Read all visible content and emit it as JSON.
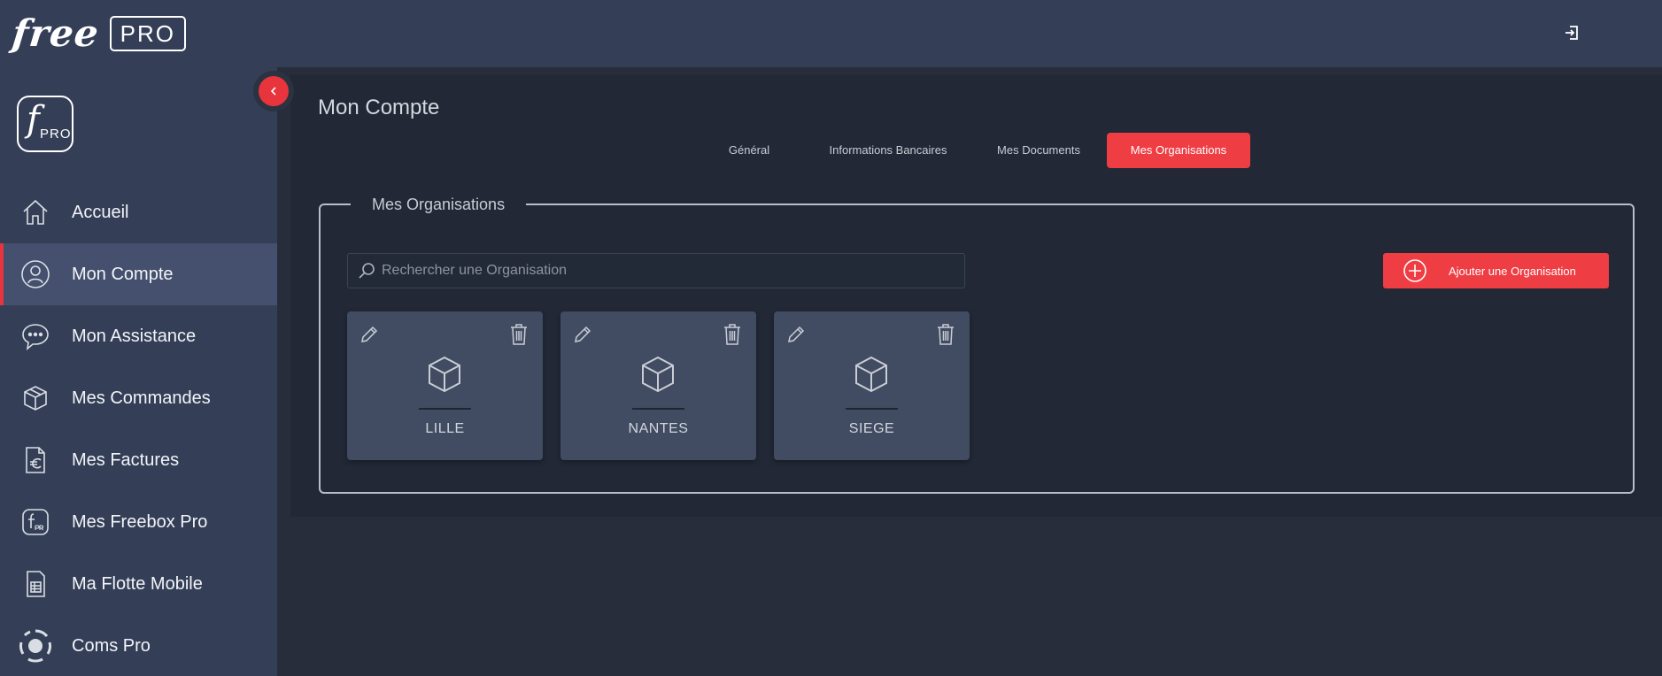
{
  "brand": {
    "word": "free",
    "badge": "PRO",
    "logo_f": "f",
    "logo_pro": "PRO"
  },
  "sidebar": {
    "items": [
      {
        "label": "Accueil",
        "icon": "home-icon",
        "active": false
      },
      {
        "label": "Mon Compte",
        "icon": "user-icon",
        "active": true
      },
      {
        "label": "Mon Assistance",
        "icon": "chat-icon",
        "active": false
      },
      {
        "label": "Mes Commandes",
        "icon": "package-icon",
        "active": false
      },
      {
        "label": "Mes Factures",
        "icon": "invoice-euro-icon",
        "active": false
      },
      {
        "label": "Mes Freebox Pro",
        "icon": "freebox-pro-icon",
        "active": false
      },
      {
        "label": "Ma Flotte Mobile",
        "icon": "sim-card-icon",
        "active": false
      },
      {
        "label": "Coms Pro",
        "icon": "coms-pro-icon",
        "active": false
      }
    ]
  },
  "main": {
    "title": "Mon Compte",
    "tabs": [
      {
        "label": "Général",
        "active": false
      },
      {
        "label": "Informations Bancaires",
        "active": false
      },
      {
        "label": "Mes Documents",
        "active": false
      },
      {
        "label": "Mes Organisations",
        "active": true
      }
    ],
    "section_title": "Mes Organisations",
    "search": {
      "placeholder": "Rechercher une Organisation",
      "value": ""
    },
    "add_button_label": "Ajouter une Organisation",
    "organisations": [
      {
        "name": "LILLE"
      },
      {
        "name": "NANTES"
      },
      {
        "name": "SIEGE"
      }
    ]
  },
  "colors": {
    "accent": "#ef3d44",
    "topbar": "#343f57",
    "sidebar": "#343f57",
    "background": "#272d3b",
    "panel": "#222836",
    "card": "#414c62"
  }
}
